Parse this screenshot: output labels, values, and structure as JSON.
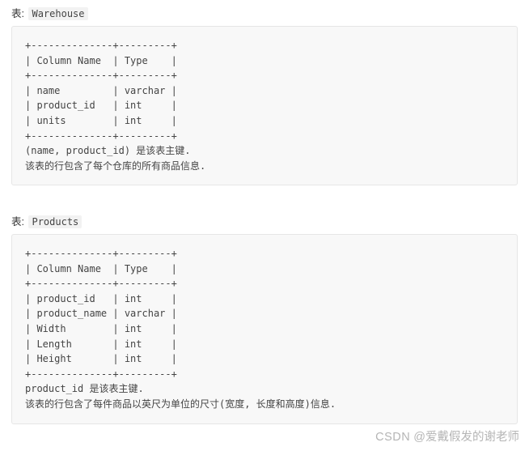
{
  "document": {
    "sections": [
      {
        "label_prefix": "表:",
        "table_name": "Warehouse",
        "code": "+--------------+---------+\n| Column Name  | Type    |\n+--------------+---------+\n| name         | varchar |\n| product_id   | int     |\n| units        | int     |\n+--------------+---------+",
        "notes": [
          "(name, product_id) 是该表主键.",
          "该表的行包含了每个仓库的所有商品信息."
        ]
      },
      {
        "label_prefix": "表:",
        "table_name": "Products",
        "code": "+--------------+---------+\n| Column Name  | Type    |\n+--------------+---------+\n| product_id   | int     |\n| product_name | varchar |\n| Width        | int     |\n| Length       | int     |\n| Height       | int     |\n+--------------+---------+",
        "notes": [
          "product_id 是该表主键.",
          "该表的行包含了每件商品以英尺为单位的尺寸(宽度, 长度和高度)信息."
        ]
      }
    ]
  },
  "watermark": {
    "brand": "CSDN",
    "author": "@爱戴假发的谢老师"
  }
}
